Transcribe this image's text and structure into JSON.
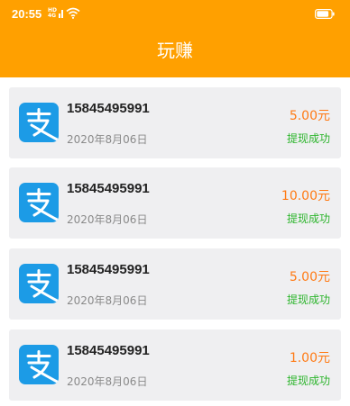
{
  "status_bar": {
    "time": "20:55",
    "network": "HD 4G",
    "battery_level": 0.85
  },
  "header": {
    "title": "玩赚",
    "color": "#FFA000"
  },
  "records": [
    {
      "phone": "15845495991",
      "date": "2020年8月06日",
      "amount": "5.00元",
      "status": "提现成功"
    },
    {
      "phone": "15845495991",
      "date": "2020年8月06日",
      "amount": "10.00元",
      "status": "提现成功"
    },
    {
      "phone": "15845495991",
      "date": "2020年8月06日",
      "amount": "5.00元",
      "status": "提现成功"
    },
    {
      "phone": "15845495991",
      "date": "2020年8月06日",
      "amount": "1.00元",
      "status": "提现成功"
    }
  ],
  "colors": {
    "amount": "#FF7A14",
    "status_success": "#2DB52D",
    "alipay_blue": "#1C9BE6",
    "card_bg": "#EFEFF1"
  },
  "icons": {
    "record_icon": "alipay-icon"
  }
}
